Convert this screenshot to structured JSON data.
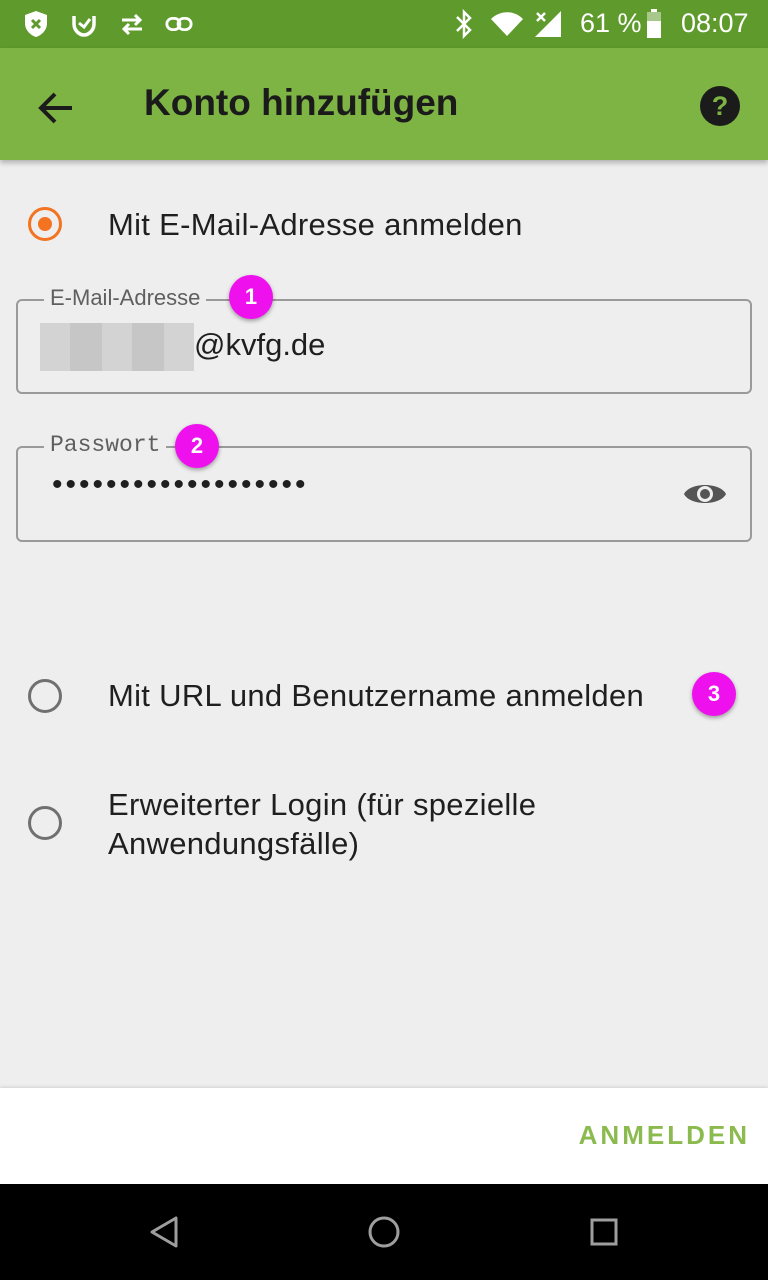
{
  "status_bar": {
    "battery_percent": "61 %",
    "time": "08:07",
    "icons": [
      "shield-x-icon",
      "notification-app-icon",
      "sync-arrows-icon",
      "link-icon",
      "bluetooth-icon",
      "wifi-icon",
      "signal-icon",
      "battery-icon"
    ]
  },
  "app_bar": {
    "title": "Konto hinzufügen",
    "back_icon": "arrow-back-icon",
    "help_icon": "help-icon"
  },
  "options": {
    "email": {
      "label": "Mit E-Mail-Adresse anmelden",
      "selected": true
    },
    "url": {
      "label": "Mit URL und Benutzername anmelden",
      "selected": false
    },
    "advanced": {
      "line1": "Erweiterter Login (für spezielle",
      "line2": "Anwendungsfälle)",
      "selected": false
    }
  },
  "email_field": {
    "label": "E-Mail-Adresse",
    "value_visible": "@kvfg.de"
  },
  "password_field": {
    "label": "Passwort",
    "masked_value": "•••••••••••••••••••",
    "toggle_icon": "eye-icon"
  },
  "annotations": [
    "1",
    "2",
    "3"
  ],
  "footer": {
    "login_label": "ANMELDEN"
  },
  "nav_bar": {
    "icons": [
      "back-triangle-icon",
      "home-circle-icon",
      "recents-square-icon"
    ]
  },
  "colors": {
    "status_bar": "#5f9a2c",
    "app_bar": "#7db443",
    "accent": "#f37321",
    "badge": "#ee11ee",
    "button_text": "#8bba4f"
  }
}
